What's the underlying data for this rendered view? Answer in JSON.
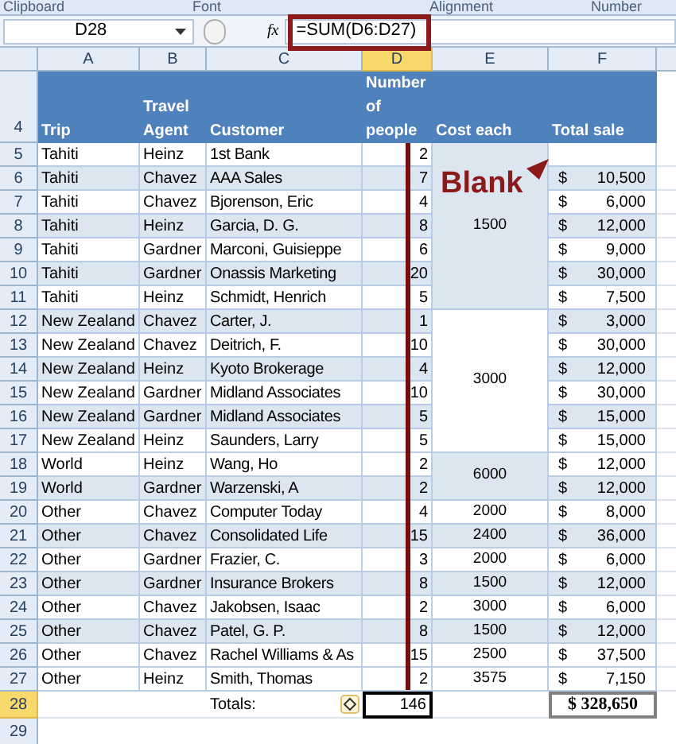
{
  "ribbon_groups": [
    "Clipboard",
    "Font",
    "Alignment",
    "Number"
  ],
  "formula_bar": {
    "name_box": "D28",
    "fx": "fx",
    "formula": "=SUM(D6:D27)"
  },
  "columns": [
    {
      "label": "A",
      "selected": false
    },
    {
      "label": "B",
      "selected": false
    },
    {
      "label": "C",
      "selected": false
    },
    {
      "label": "D",
      "selected": true
    },
    {
      "label": "E",
      "selected": false
    },
    {
      "label": "F",
      "selected": false
    }
  ],
  "header_row": {
    "num": "4",
    "cells": [
      "Trip",
      "Travel Agent",
      "Customer",
      "Number of people",
      "Cost each",
      "Total sale"
    ]
  },
  "rows": [
    {
      "num": "5",
      "trip": "Tahiti",
      "agent": "Heinz",
      "customer": "1st Bank",
      "people": "2",
      "cost": {
        "text": "1500",
        "shaded": true
      },
      "shaded": false,
      "selected": false
    },
    {
      "num": "6",
      "trip": "Tahiti",
      "agent": "Chavez",
      "customer": "AAA Sales",
      "people": "7",
      "total": "10,500",
      "shaded": true,
      "selected": false
    },
    {
      "num": "7",
      "trip": "Tahiti",
      "agent": "Chavez",
      "customer": "Bjorenson, Eric",
      "people": "4",
      "total": "6,000",
      "shaded": false,
      "selected": false
    },
    {
      "num": "8",
      "trip": "Tahiti",
      "agent": "Heinz",
      "customer": "Garcia, D. G.",
      "people": "8",
      "total": "12,000",
      "shaded": true,
      "selected": false
    },
    {
      "num": "9",
      "trip": "Tahiti",
      "agent": "Gardner",
      "customer": "Marconi, Guisieppe",
      "people": "6",
      "total": "9,000",
      "shaded": false,
      "selected": false
    },
    {
      "num": "10",
      "trip": "Tahiti",
      "agent": "Gardner",
      "customer": "Onassis Marketing",
      "people": "20",
      "total": "30,000",
      "shaded": true,
      "selected": false
    },
    {
      "num": "11",
      "trip": "Tahiti",
      "agent": "Heinz",
      "customer": "Schmidt, Henrich",
      "people": "5",
      "total": "7,500",
      "shaded": false,
      "selected": false
    },
    {
      "num": "12",
      "trip": "New Zealand",
      "agent": "Chavez",
      "customer": "Carter, J.",
      "people": "1",
      "cost": {
        "text": "3000",
        "shaded": false
      },
      "total": "3,000",
      "shaded": true,
      "selected": false
    },
    {
      "num": "13",
      "trip": "New Zealand",
      "agent": "Chavez",
      "customer": "Deitrich, F.",
      "people": "10",
      "total": "30,000",
      "shaded": false,
      "selected": false
    },
    {
      "num": "14",
      "trip": "New Zealand",
      "agent": "Heinz",
      "customer": "Kyoto Brokerage",
      "people": "4",
      "total": "12,000",
      "shaded": true,
      "selected": false
    },
    {
      "num": "15",
      "trip": "New Zealand",
      "agent": "Gardner",
      "customer": "Midland Associates",
      "people": "10",
      "total": "30,000",
      "shaded": false,
      "selected": false
    },
    {
      "num": "16",
      "trip": "New Zealand",
      "agent": "Gardner",
      "customer": "Midland Associates",
      "people": "5",
      "total": "15,000",
      "shaded": true,
      "selected": false
    },
    {
      "num": "17",
      "trip": "New Zealand",
      "agent": "Heinz",
      "customer": "Saunders, Larry",
      "people": "5",
      "total": "15,000",
      "shaded": false,
      "selected": false
    },
    {
      "num": "18",
      "trip": "World",
      "agent": "Heinz",
      "customer": "Wang, Ho",
      "people": "2",
      "cost": {
        "text": "6000",
        "shaded": true
      },
      "total": "12,000",
      "shaded": false,
      "selected": false
    },
    {
      "num": "19",
      "trip": "World",
      "agent": "Gardner",
      "customer": "Warzenski, A",
      "people": "2",
      "total": "12,000",
      "shaded": true,
      "selected": false
    },
    {
      "num": "20",
      "trip": "Other",
      "agent": "Chavez",
      "customer": "Computer Today",
      "people": "4",
      "cost": {
        "text": "2000",
        "shaded": false
      },
      "total": "8,000",
      "shaded": false,
      "selected": false
    },
    {
      "num": "21",
      "trip": "Other",
      "agent": "Chavez",
      "customer": "Consolidated Life",
      "people": "15",
      "cost": {
        "text": "2400",
        "shaded": true
      },
      "total": "36,000",
      "shaded": true,
      "selected": false
    },
    {
      "num": "22",
      "trip": "Other",
      "agent": "Gardner",
      "customer": "Frazier, C.",
      "people": "3",
      "cost": {
        "text": "2000",
        "shaded": false
      },
      "total": "6,000",
      "shaded": false,
      "selected": false
    },
    {
      "num": "23",
      "trip": "Other",
      "agent": "Gardner",
      "customer": "Insurance Brokers",
      "people": "8",
      "cost": {
        "text": "1500",
        "shaded": true
      },
      "total": "12,000",
      "shaded": true,
      "selected": false
    },
    {
      "num": "24",
      "trip": "Other",
      "agent": "Chavez",
      "customer": "Jakobsen, Isaac",
      "people": "2",
      "cost": {
        "text": "3000",
        "shaded": false
      },
      "total": "6,000",
      "shaded": false,
      "selected": false
    },
    {
      "num": "25",
      "trip": "Other",
      "agent": "Chavez",
      "customer": "Patel, G. P.",
      "people": "8",
      "cost": {
        "text": "1500",
        "shaded": true
      },
      "total": "12,000",
      "shaded": true,
      "selected": false
    },
    {
      "num": "26",
      "trip": "Other",
      "agent": "Chavez",
      "customer": "Rachel Williams & As",
      "people": "15",
      "cost": {
        "text": "2500",
        "shaded": false
      },
      "total": "37,500",
      "shaded": false,
      "selected": false
    },
    {
      "num": "27",
      "trip": "Other",
      "agent": "Heinz",
      "customer": "Smith, Thomas",
      "people": "2",
      "cost": {
        "text": "3575",
        "shaded": false
      },
      "total": "7,150",
      "shaded": false,
      "selected": false
    }
  ],
  "currency": "$",
  "totals_row": {
    "num": "28",
    "selected": true,
    "label": "Totals:",
    "people": "146",
    "total": "$ 328,650"
  },
  "empty_row": {
    "num": "29",
    "selected": false
  },
  "annotation": {
    "text": "Blank"
  }
}
